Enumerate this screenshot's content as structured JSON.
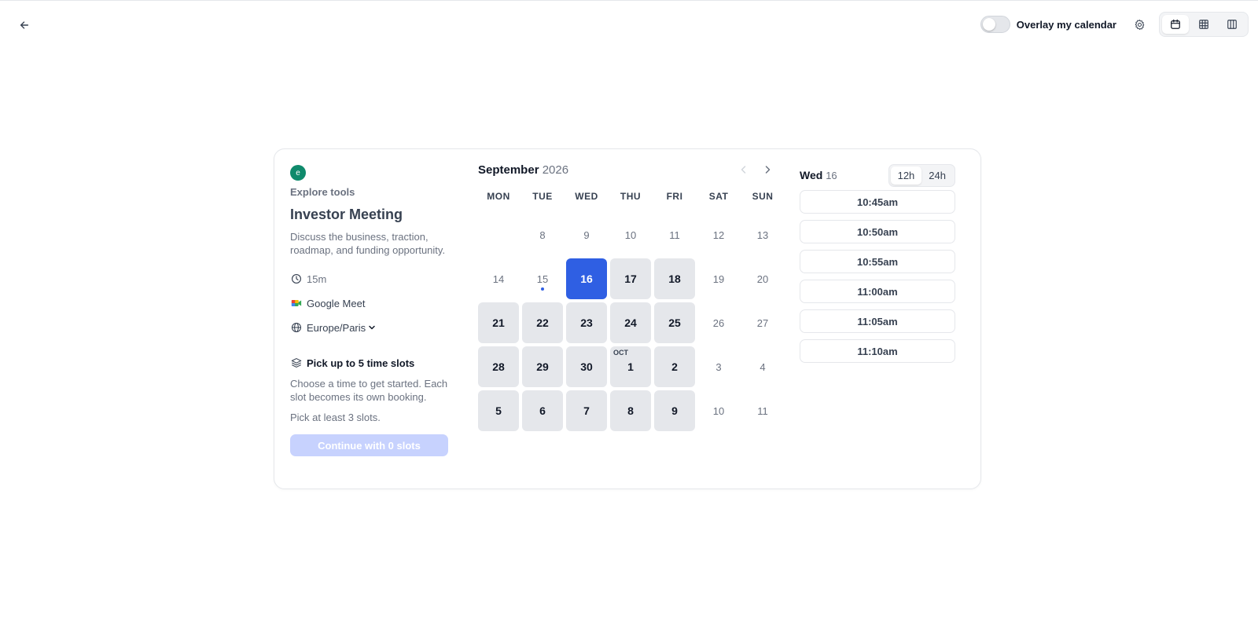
{
  "topbar": {
    "overlay_label": "Overlay my calendar",
    "overlay_enabled": false,
    "views": [
      "month-view",
      "week-view",
      "column-view"
    ],
    "active_view": "month-view"
  },
  "event": {
    "avatar_letter": "e",
    "avatar_color": "#0f8a6c",
    "org_name": "Explore tools",
    "title": "Investor Meeting",
    "description": "Discuss the business, traction, roadmap, and funding opportunity.",
    "duration": "15m",
    "location": "Google Meet",
    "timezone": "Europe/Paris",
    "pick_title": "Pick up to 5 time slots",
    "pick_description": "Choose a time to get started. Each slot becomes its own booking.",
    "pick_minimum": "Pick at least 3 slots.",
    "continue_label": "Continue with 0 slots"
  },
  "calendar": {
    "month": "September",
    "year": "2026",
    "weekdays": [
      "MON",
      "TUE",
      "WED",
      "THU",
      "FRI",
      "SAT",
      "SUN"
    ],
    "days": [
      {
        "label": "",
        "state": "empty"
      },
      {
        "label": "8",
        "state": "disabled"
      },
      {
        "label": "9",
        "state": "disabled"
      },
      {
        "label": "10",
        "state": "disabled"
      },
      {
        "label": "11",
        "state": "disabled"
      },
      {
        "label": "12",
        "state": "disabled"
      },
      {
        "label": "13",
        "state": "disabled"
      },
      {
        "label": "14",
        "state": "disabled"
      },
      {
        "label": "15",
        "state": "disabled",
        "today": true
      },
      {
        "label": "16",
        "state": "selected"
      },
      {
        "label": "17",
        "state": "available"
      },
      {
        "label": "18",
        "state": "available"
      },
      {
        "label": "19",
        "state": "disabled"
      },
      {
        "label": "20",
        "state": "disabled"
      },
      {
        "label": "21",
        "state": "available"
      },
      {
        "label": "22",
        "state": "available"
      },
      {
        "label": "23",
        "state": "available"
      },
      {
        "label": "24",
        "state": "available"
      },
      {
        "label": "25",
        "state": "available"
      },
      {
        "label": "26",
        "state": "disabled"
      },
      {
        "label": "27",
        "state": "disabled"
      },
      {
        "label": "28",
        "state": "available"
      },
      {
        "label": "29",
        "state": "available"
      },
      {
        "label": "30",
        "state": "available"
      },
      {
        "label": "1",
        "state": "available",
        "month_tag": "OCT"
      },
      {
        "label": "2",
        "state": "available"
      },
      {
        "label": "3",
        "state": "disabled"
      },
      {
        "label": "4",
        "state": "disabled"
      },
      {
        "label": "5",
        "state": "available"
      },
      {
        "label": "6",
        "state": "available"
      },
      {
        "label": "7",
        "state": "available"
      },
      {
        "label": "8",
        "state": "available"
      },
      {
        "label": "9",
        "state": "available"
      },
      {
        "label": "10",
        "state": "disabled"
      },
      {
        "label": "11",
        "state": "disabled"
      }
    ]
  },
  "slots_panel": {
    "day_name": "Wed",
    "day_number": "16",
    "format_12": "12h",
    "format_24": "24h",
    "active_format": "12h",
    "times": [
      "10:45am",
      "10:50am",
      "10:55am",
      "11:00am",
      "11:05am",
      "11:10am"
    ]
  },
  "colors": {
    "accent": "#2f5fe3",
    "disabled_button": "#c7d2fe",
    "available_day": "#e5e7eb"
  }
}
